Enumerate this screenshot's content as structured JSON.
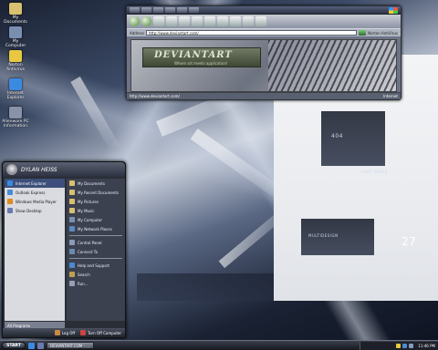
{
  "desktop": {
    "icons": [
      {
        "label": "My Documents",
        "color": "#d8c070"
      },
      {
        "label": "My Computer",
        "color": "#7a8fb0"
      },
      {
        "label": "Norton Antivirus",
        "color": "#e8c840"
      },
      {
        "label": "Internet Explorer",
        "color": "#3a8ae0"
      },
      {
        "label": "Alienware PC Information",
        "color": "#8892a8"
      }
    ],
    "wallpaper_text": {
      "tag1": "404",
      "tag2": "LAST SPACE",
      "tag3": "MULTIDESIGN",
      "tag4": "27"
    }
  },
  "browser": {
    "address_label": "Address",
    "url": "http://www.deviantart.com/",
    "links_label": "Norton AntiVirus",
    "banner_title": "DEVIANTART",
    "banner_sub": "Where art meets application!",
    "status_text": "http://www.deviantart.com/",
    "zone_text": "Internet"
  },
  "startmenu": {
    "username": "DYLAN HEISS",
    "pinned": [
      {
        "label": "Internet Explorer",
        "color": "#3a8ae0"
      },
      {
        "label": "Outlook Express",
        "color": "#4a8ad0"
      },
      {
        "label": "Windows Media Player",
        "color": "#e08a20"
      },
      {
        "label": "Show Desktop",
        "color": "#6a7ab0"
      }
    ],
    "right_items": [
      {
        "label": "My Documents",
        "color": "#d8c070"
      },
      {
        "label": "My Recent Documents",
        "color": "#d8c070"
      },
      {
        "label": "My Pictures",
        "color": "#d8c070"
      },
      {
        "label": "My Music",
        "color": "#d8c070"
      },
      {
        "label": "My Computer",
        "color": "#7a8fb0"
      },
      {
        "label": "My Network Places",
        "color": "#5a8ac0"
      }
    ],
    "right_items2": [
      {
        "label": "Control Panel",
        "color": "#8a9ab8"
      },
      {
        "label": "Connect To",
        "color": "#6a8ab0"
      },
      {
        "label": "Help and Support",
        "color": "#4a8ad0"
      },
      {
        "label": "Search",
        "color": "#c0a050"
      },
      {
        "label": "Run...",
        "color": "#9aa0b0"
      }
    ],
    "all_programs": "All Programs",
    "log_off": "Log Off",
    "turn_off": "Turn Off Computer"
  },
  "taskbar": {
    "start_label": "START",
    "task_label": "DEVIANTART.COM - ...",
    "clock": "11:46 PM"
  }
}
